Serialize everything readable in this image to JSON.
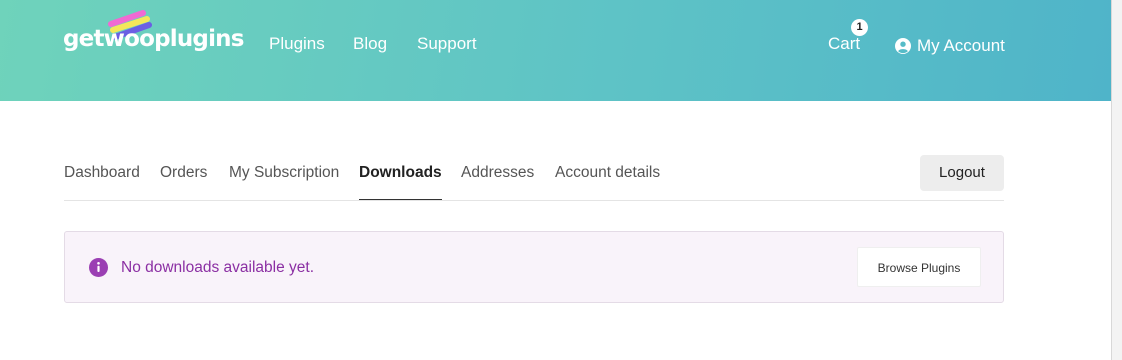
{
  "header": {
    "logo_text": "getwooplugins",
    "nav": [
      "Plugins",
      "Blog",
      "Support"
    ],
    "cart_label": "Cart",
    "cart_count": "1",
    "account_label": "My Account"
  },
  "tabs": [
    {
      "label": "Dashboard",
      "active": false
    },
    {
      "label": "Orders",
      "active": false
    },
    {
      "label": "My Subscription",
      "active": false
    },
    {
      "label": "Downloads",
      "active": true
    },
    {
      "label": "Addresses",
      "active": false
    },
    {
      "label": "Account details",
      "active": false
    }
  ],
  "logout_label": "Logout",
  "notice": {
    "message": "No downloads available yet.",
    "button_label": "Browse Plugins"
  },
  "colors": {
    "header_gradient_start": "#6fd3bb",
    "header_gradient_end": "#4fb4c9",
    "notice_text": "#8b2fa3",
    "notice_icon": "#9b3fb3",
    "notice_bg": "#f9f3fa"
  },
  "icons": {
    "account": "user-circle-icon",
    "notice": "info-icon",
    "logo": "color-brush-strokes-icon"
  }
}
